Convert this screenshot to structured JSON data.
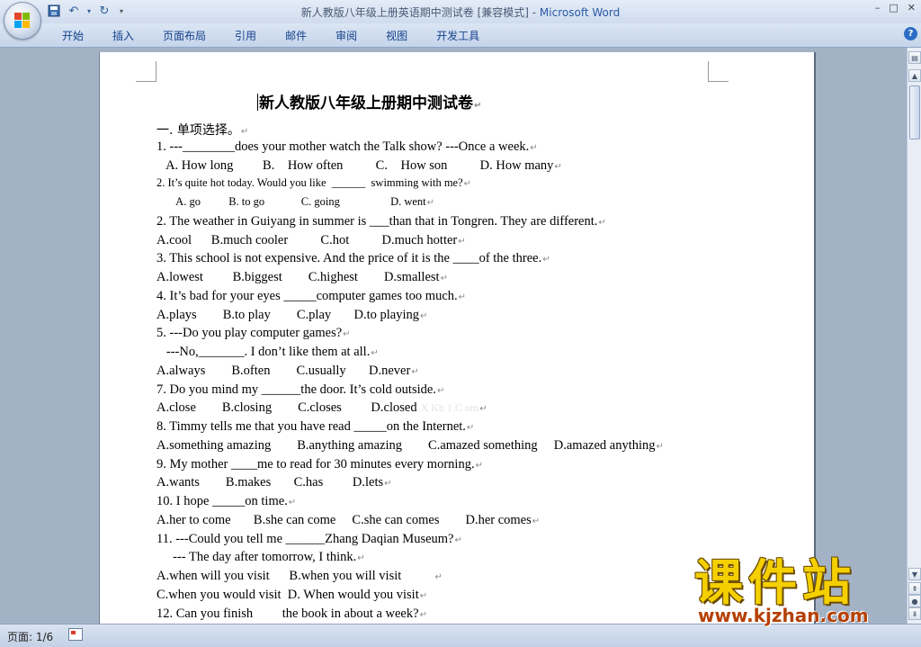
{
  "window": {
    "title": "新人教版八年级上册英语期中测试卷 [兼容模式] - ",
    "app": "Microsoft Word",
    "minimize": "–",
    "maximize": "□",
    "close": "✕"
  },
  "qat": {
    "save_icon": "save-icon",
    "undo": "↶",
    "redo": "↻",
    "more": "▾"
  },
  "ribbon": {
    "tabs": [
      "开始",
      "插入",
      "页面布局",
      "引用",
      "邮件",
      "审阅",
      "视图",
      "开发工具"
    ],
    "help": "?"
  },
  "document": {
    "title": "新人教版八年级上册期中测试卷",
    "lines": [
      {
        "text": "一. 单项选择。",
        "cls": "cn"
      },
      {
        "text": "1. ---________does your mother watch the Talk show? ---Once a week."
      },
      {
        "text": "   A. How long         B.    How often          C.    How son          D. How many"
      },
      {
        "text": "2. It’s quite hot today. Would you like  ______  swimming with me?",
        "cls": "sm"
      },
      {
        "text": "       A. go          B. to go             C. going                  D. went",
        "cls": "sm"
      },
      {
        "text": "2. The weather in Guiyang in summer is ___than that in Tongren. They are different."
      },
      {
        "text": "A.cool      B.much cooler          C.hot          D.much hotter"
      },
      {
        "text": "3. This school is not expensive. And the price of it is the ____of the three."
      },
      {
        "text": "A.lowest         B.biggest        C.highest        D.smallest"
      },
      {
        "text": "4. It’s bad for your eyes _____computer games too much."
      },
      {
        "text": "A.plays        B.to play        C.play       D.to playing"
      },
      {
        "text": "5. ---Do you play computer games?"
      },
      {
        "text": "   ---No,_______. I don’t like them at all."
      },
      {
        "text": "A.always        B.often        C.usually       D.never"
      },
      {
        "text": "7. Do you mind my ______the door. It’s cold outside."
      },
      {
        "text": "A.close        B.closing        C.closes         D.closed",
        "wm": "X Kb 1.C om"
      },
      {
        "text": "8. Timmy tells me that you have read _____on the Internet."
      },
      {
        "text": "A.something amazing        B.anything amazing        C.amazed something     D.amazed anything"
      },
      {
        "text": "9. My mother ____me to read for 30 minutes every morning."
      },
      {
        "text": "A.wants        B.makes       C.has         D.lets"
      },
      {
        "text": "10. I hope _____on time."
      },
      {
        "text": "A.her to come       B.she can come     C.she can comes        D.her comes"
      },
      {
        "text": "11. ---Could you tell me ______Zhang Daqian Museum?"
      },
      {
        "text": "     --- The day after tomorrow, I think."
      },
      {
        "text": "A.when will you visit      B.when you will visit          "
      },
      {
        "text": "C.when you would visit  D. When would you visit"
      },
      {
        "text": "12. Can you finish         the book in about a week?"
      }
    ]
  },
  "status": {
    "page": "页面: 1/6"
  },
  "watermark_logo": {
    "big": "课件站",
    "url": "www.kjzhan.com"
  },
  "colors": {
    "title_app": "#2a5aa6",
    "ribbon_tab": "#15428b",
    "logo_yellow": "#f5d000"
  }
}
